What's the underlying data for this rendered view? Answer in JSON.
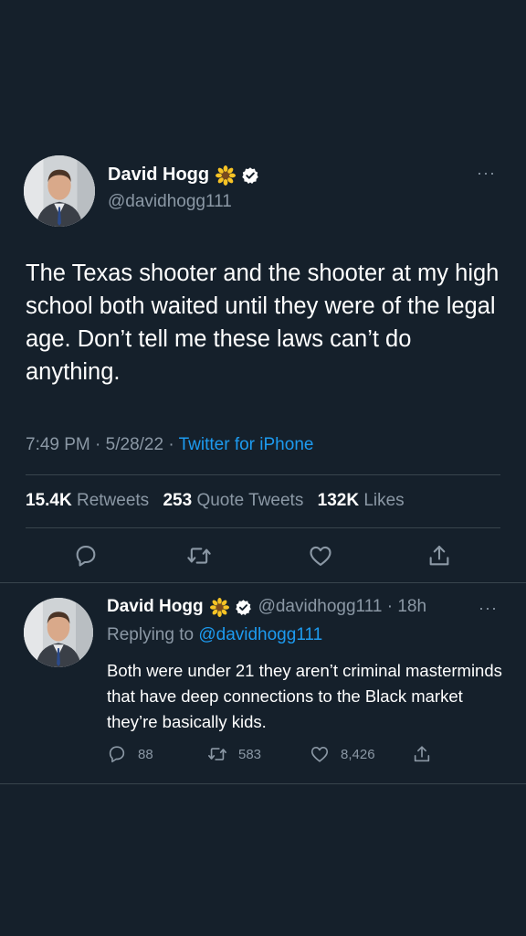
{
  "tweet": {
    "author": {
      "display_name": "David Hogg",
      "handle": "@davidhogg111",
      "avatar_icon": "avatar-photo",
      "badge_emoji": "sunflower-icon",
      "verified_icon": "verified-badge-icon"
    },
    "more_icon": "···",
    "text": "The Texas shooter and the shooter at my high school both waited until they were of the legal age. Don’t tell me these laws can’t do anything.",
    "time": "7:49 PM",
    "date": "5/28/22",
    "separator": "·",
    "source": "Twitter for iPhone",
    "stats": {
      "retweets_count": "15.4K",
      "retweets_label": "Retweets",
      "quotes_count": "253",
      "quotes_label": "Quote Tweets",
      "likes_count": "132K",
      "likes_label": "Likes"
    },
    "actions": [
      "reply-icon",
      "retweet-icon",
      "like-icon",
      "share-icon"
    ]
  },
  "reply": {
    "author": {
      "display_name": "David Hogg",
      "handle": "@davidhogg111",
      "time_ago": "18h"
    },
    "more_icon": "···",
    "replying_to_label": "Replying to",
    "replying_to_handle": "@davidhogg111",
    "text": "Both were under 21 they aren’t criminal masterminds that have deep connections to the Black market they’re basically kids.",
    "reply_count": "88",
    "retweet_count": "583",
    "like_count": "8,426"
  },
  "colors": {
    "background": "#15202b",
    "text_primary": "#ffffff",
    "text_secondary": "#8b98a5",
    "accent": "#1d9bf0",
    "divider": "#38444d"
  }
}
